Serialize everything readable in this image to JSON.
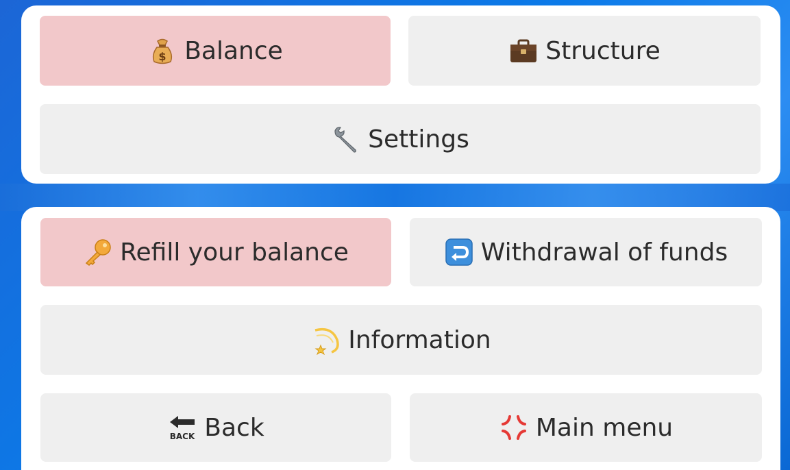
{
  "top_menu": {
    "balance_label": "Balance",
    "structure_label": "Structure",
    "settings_label": "Settings"
  },
  "bottom_menu": {
    "refill_label": "Refill your balance",
    "withdrawal_label": "Withdrawal of funds",
    "information_label": "Information",
    "back_label": "Back",
    "main_menu_label": "Main menu"
  },
  "icons": {
    "balance": "money-bag-icon",
    "structure": "briefcase-icon",
    "settings": "wrench-icon",
    "refill": "key-icon",
    "withdrawal": "return-arrow-icon",
    "information": "dizzy-star-icon",
    "back": "back-arrow-icon",
    "main_menu": "anger-symbol-icon"
  },
  "back_icon_text": "BACK",
  "colors": {
    "background": "#0b7ae8",
    "panel": "#ffffff",
    "button": "#efefef",
    "button_active": "#f2c8ca",
    "text": "#2b2b2b"
  }
}
